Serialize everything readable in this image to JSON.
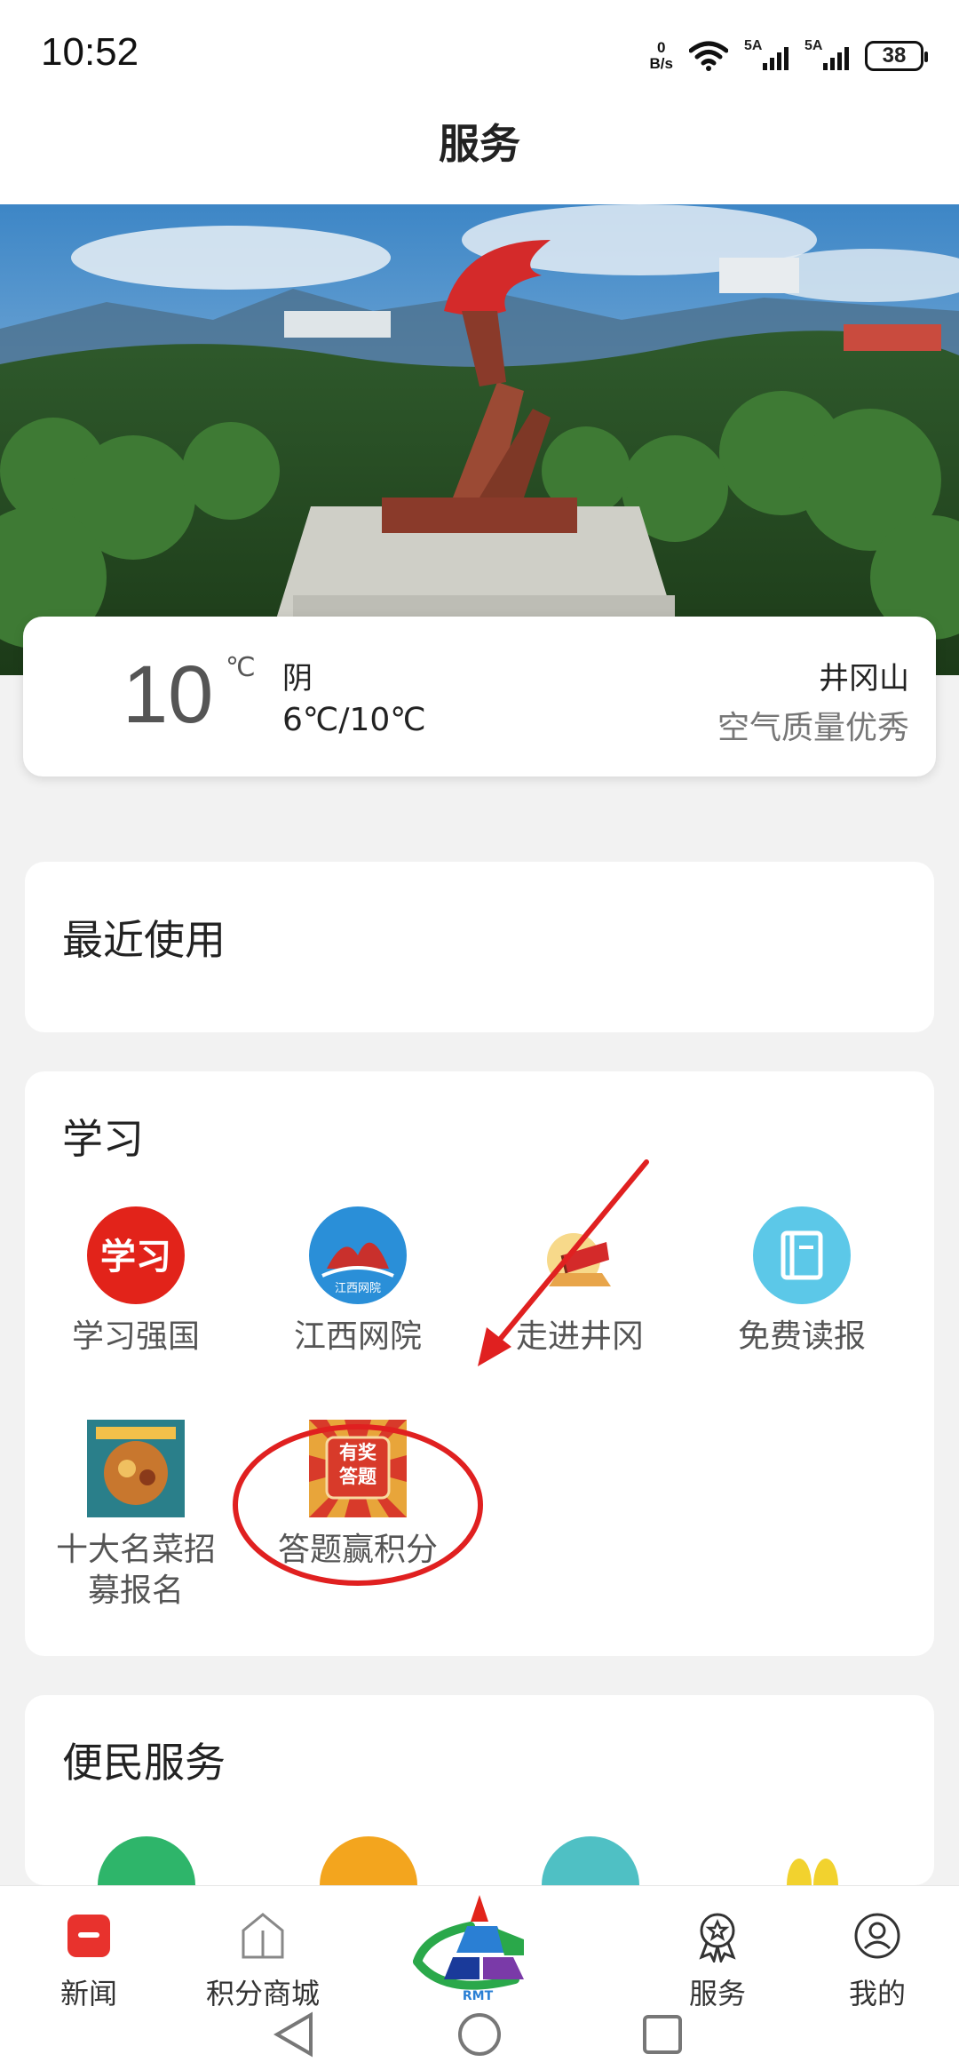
{
  "status": {
    "time": "10:52",
    "net_speed_value": "0",
    "net_speed_unit": "B/s",
    "sim1": "5A",
    "sim2": "5A",
    "battery": "38"
  },
  "header": {
    "title": "服务"
  },
  "weather": {
    "temperature": "10",
    "unit": "℃",
    "condition": "阴",
    "range": "6℃/10℃",
    "city": "井冈山",
    "air_quality": "空气质量优秀"
  },
  "recent": {
    "title": "最近使用"
  },
  "study": {
    "title": "学习",
    "items": [
      {
        "label": "学习强国",
        "icon": "xuexi-qiangguo-icon"
      },
      {
        "label": "江西网院",
        "icon": "jiangxi-wangyuan-icon"
      },
      {
        "label": "走进井冈",
        "icon": "zoujin-jinggang-icon"
      },
      {
        "label": "免费读报",
        "icon": "book-icon"
      },
      {
        "label": "十大名菜招募报名",
        "line1": "十大名菜招",
        "line2": "募报名",
        "icon": "dish-icon"
      },
      {
        "label": "答题赢积分",
        "icon": "quiz-icon",
        "badge_line1": "有奖",
        "badge_line2": "答题"
      }
    ]
  },
  "convenience": {
    "title": "便民服务"
  },
  "bottom_nav": {
    "items": [
      {
        "label": "新闻",
        "icon": "news-icon"
      },
      {
        "label": "积分商城",
        "icon": "points-mall-icon"
      },
      {
        "label": "",
        "icon": "rmt-logo-icon",
        "logo_text": "RMT"
      },
      {
        "label": "服务",
        "icon": "service-icon"
      },
      {
        "label": "我的",
        "icon": "profile-icon"
      }
    ]
  },
  "colors": {
    "accent_red": "#e8322d",
    "annotation_red": "#e02020",
    "nav_active": "#e8322d"
  }
}
